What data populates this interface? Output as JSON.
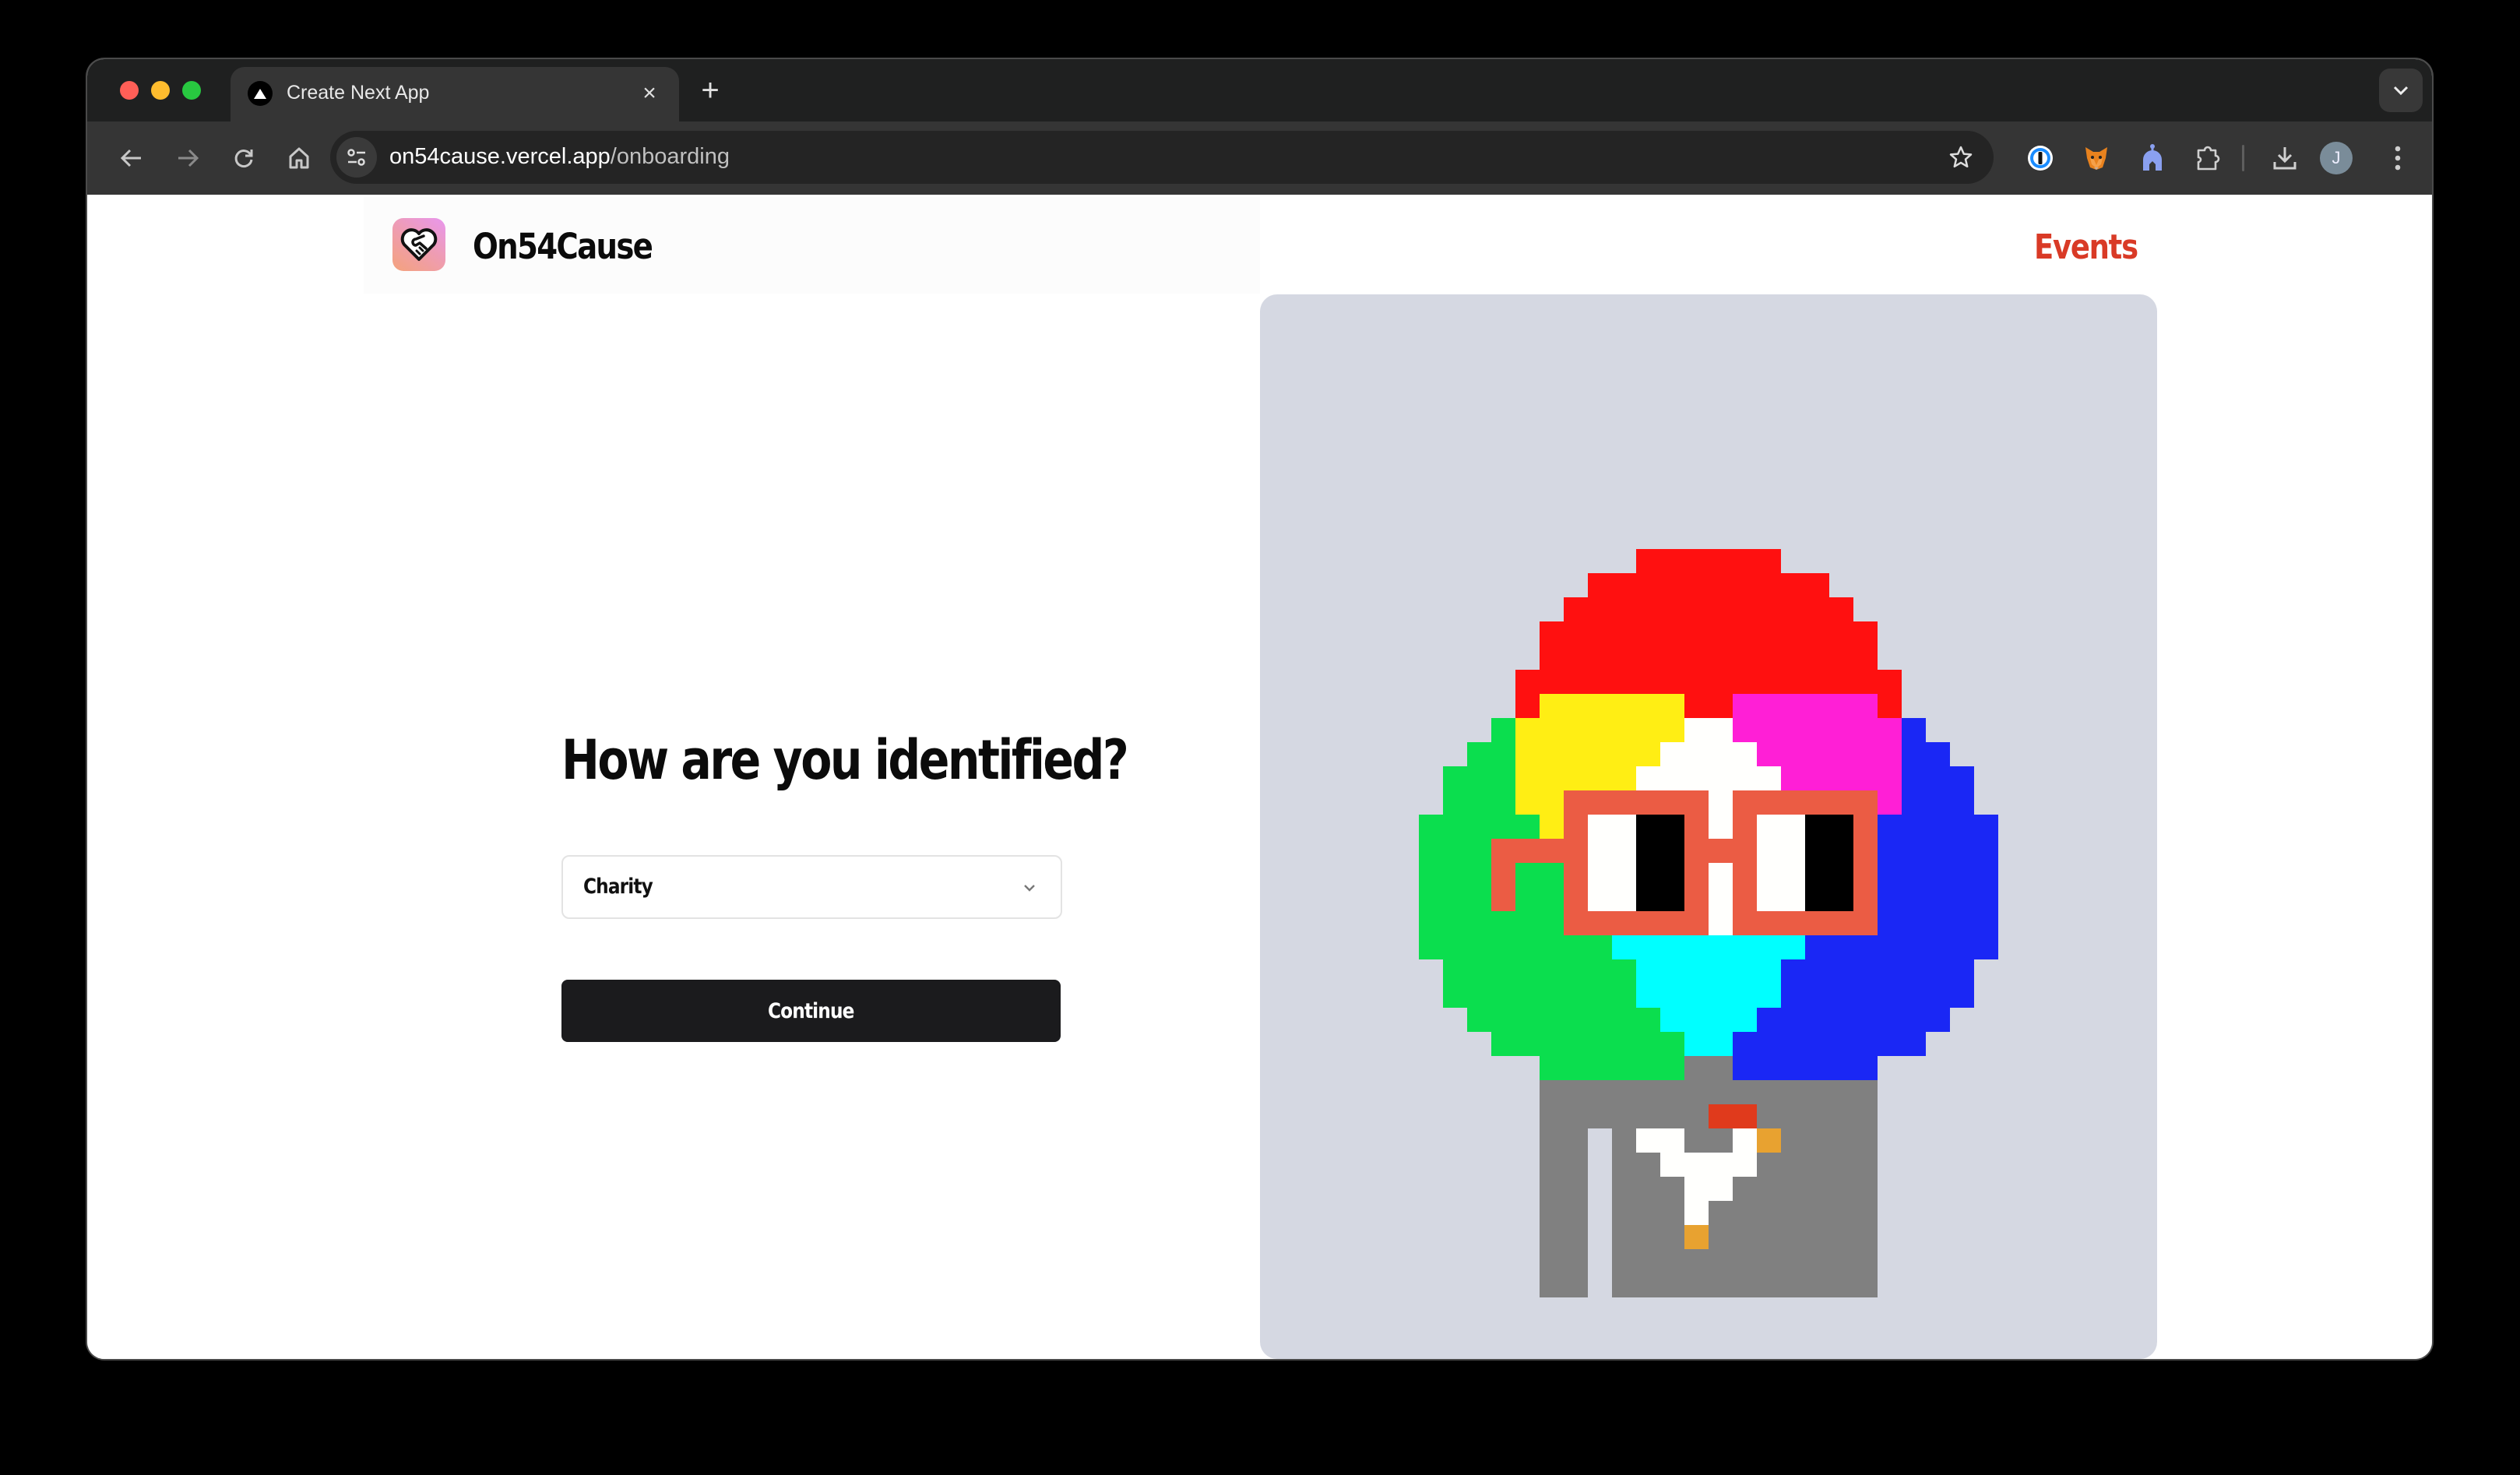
{
  "browser": {
    "tab": {
      "title": "Create Next App",
      "favicon": "nextjs-triangle-icon",
      "close_label": "×"
    },
    "new_tab_label": "+",
    "url": {
      "domain": "on54cause.vercel.app",
      "path": "/onboarding"
    },
    "profile_initial": "J",
    "extensions": [
      "1password-icon",
      "metamask-fox-icon",
      "helmet-extension-icon",
      "puzzle-extensions-icon"
    ],
    "traffic_lights": [
      "#ff5f57",
      "#febc2e",
      "#28c840"
    ]
  },
  "header": {
    "brand": "On54Cause",
    "nav_events": "Events",
    "accent_color": "#d93a26"
  },
  "onboarding": {
    "heading": "How are you identified?",
    "select": {
      "value": "Charity"
    },
    "continue_label": "Continue"
  },
  "avatar_art": {
    "background": "#d5d8e2",
    "palette": {
      "R": "#ff1010",
      "Y": "#ffee14",
      "M": "#ff1fd6",
      "W": "#fffffd",
      "G": "#0bde4e",
      "B": "#1a27f5",
      "C": "#00ffff",
      "O": "#eb5c44",
      "K": "#000000",
      "S": "#808080",
      "D": "#e03a1c",
      "A": "#e8a230"
    },
    "rows": [
      ".........RRRRRR.........",
      ".......RRRRRRRRRR.......",
      "......RRRRRRRRRRRR......",
      ".....RRRRRRRRRRRRRR.....",
      ".....RRRRRRRRRRRRRR.....",
      "....RRRRRRRRRRRRRRRR....",
      "....RYYYYYYRRMMMMMMR....",
      "...GYYYYYYYWWMMMMMMMB...",
      "..GGYYYYYYWWWWMMMMMMBB..",
      ".GGGYYYYYWWWWWWMMMMMBBB.",
      ".GGGYYOOOOOOWOOOOOOMBBB.",
      "GGGGGYOWWKKOWOWWKKOBBBBB",
      "GGGOOOOWWKKOOOWWKKOBBBBB",
      "GGGOGGOWWKKOWOWWKKOBBBBB",
      "GGGOGGOWWKKOWOWWKKOBBBBB",
      "GGGGGGOOOOOOWOOOOOOBBBBB",
      "GGGGGGGGCCCCCCCCBBBBBBBB",
      ".GGGGGGGGCCCCCCBBBBBBBB.",
      ".GGGGGGGGCCCCCCBBBBBBBB.",
      "..GGGGGGGGCCCCBBBBBBBB..",
      "...GGGGGGGGCCBBBBBBBB...",
      ".....GGGGGGSSBBBBBB.....",
      ".....SSSSSSSSSSSSSS.....",
      ".....SSSSSSSDDSSSSS.....",
      ".....SS.SWWSSWASSSS.....",
      ".....SS.SSWWWWSSSSS.....",
      ".....SS.SSSWWSSSSSS.....",
      ".....SS.SSSWSSSSSSS.....",
      ".....SS.SSSASSSSSSS.....",
      ".....SS.SSSSSSSSSSS.....",
      ".....SS.SSSSSSSSSSS....."
    ]
  }
}
